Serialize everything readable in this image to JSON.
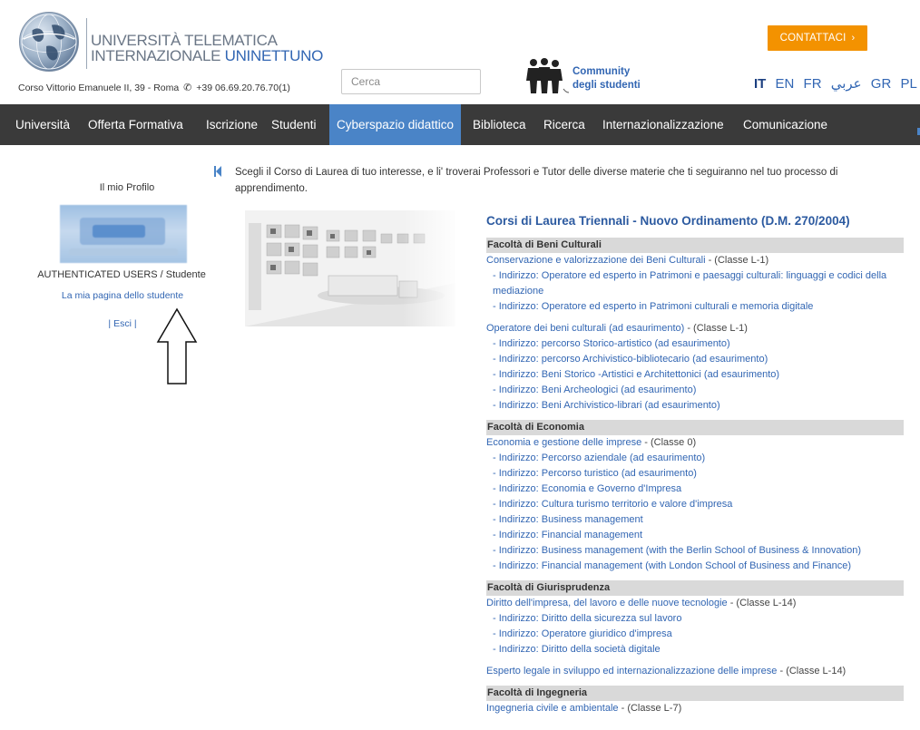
{
  "header": {
    "logo_line1": "UNIVERSITÀ TELEMATICA",
    "logo_line2_prefix": "INTERNAZIONALE ",
    "logo_line2_accent": "UNINETTUNO",
    "address_text": "Corso Vittorio Emanuele II, 39 - Roma",
    "phone_number": "+39 06.69.20.76.70(1)",
    "search_placeholder": "Cerca",
    "community_line1": "Community",
    "community_line2": "degli studenti",
    "contact_label": "CONTATTACI",
    "contact_color": "#f39200",
    "languages": [
      "IT",
      "EN",
      "FR",
      "عربي",
      "GR",
      "PL"
    ],
    "active_language": "IT"
  },
  "nav": {
    "items": [
      "Università",
      "Offerta Formativa",
      "Iscrizione",
      "Studenti",
      "Cyberspazio didattico",
      "Biblioteca",
      "Ricerca",
      "Internazionalizzazione",
      "Comunicazione"
    ],
    "active": "Cyberspazio didattico",
    "bar_color": "#3a3a3a",
    "active_color": "#4a84c7"
  },
  "sidebar": {
    "title": "Il mio Profilo",
    "role": "AUTHENTICATED USERS / Studente",
    "student_page_link": "La mia pagina dello studente",
    "logout": "| Esci |"
  },
  "main": {
    "intro": "Scegli il Corso di Laurea di tuo interesse, e li' troverai Professori e Tutor delle diverse materie che ti seguiranno nel tuo processo di apprendimento.",
    "section_title": "Corsi di Laurea Triennali - Nuovo Ordinamento (D.M. 270/2004)",
    "faculties": [
      {
        "name": "Facoltà di Beni Culturali",
        "courses": [
          {
            "name": "Conservazione e valorizzazione dei Beni Culturali",
            "classe": " - (Classe L-1)",
            "indirizzi": [
              "- Indirizzo: Operatore ed esperto in Patrimoni e paesaggi culturali: linguaggi e codici della mediazione",
              "- Indirizzo: Operatore ed esperto in Patrimoni culturali e memoria digitale"
            ]
          },
          {
            "name": "Operatore dei beni culturali (ad esaurimento)",
            "classe": " - (Classe L-1)",
            "indirizzi": [
              "- Indirizzo: percorso Storico-artistico (ad esaurimento)",
              "- Indirizzo: percorso Archivistico-bibliotecario (ad esaurimento)",
              "- Indirizzo: Beni Storico -Artistici e Architettonici (ad esaurimento)",
              "- Indirizzo: Beni Archeologici (ad esaurimento)",
              "- Indirizzo: Beni Archivistico-librari (ad esaurimento)"
            ]
          }
        ]
      },
      {
        "name": "Facoltà di Economia",
        "courses": [
          {
            "name": "Economia e gestione delle imprese",
            "classe": " - (Classe 0)",
            "indirizzi": [
              "- Indirizzo: Percorso aziendale (ad esaurimento)",
              "- Indirizzo: Percorso turistico (ad esaurimento)",
              "- Indirizzo: Economia e Governo d'Impresa",
              "- Indirizzo: Cultura turismo territorio e valore d'impresa",
              "- Indirizzo: Business management",
              "- Indirizzo: Financial management",
              "- Indirizzo: Business management (with the Berlin School of Business & Innovation)",
              "- Indirizzo: Financial management (with London School of Business and Finance)"
            ]
          }
        ]
      },
      {
        "name": "Facoltà di Giurisprudenza",
        "courses": [
          {
            "name": "Diritto dell'impresa, del lavoro e delle nuove tecnologie",
            "classe": " - (Classe L-14)",
            "indirizzi": [
              "- Indirizzo: Diritto della sicurezza sul lavoro",
              "- Indirizzo: Operatore giuridico d'impresa",
              "- Indirizzo: Diritto della società digitale"
            ]
          },
          {
            "name": "Esperto legale in sviluppo ed internazionalizzazione delle imprese",
            "classe": " - (Classe L-14)",
            "indirizzi": []
          }
        ]
      },
      {
        "name": "Facoltà di Ingegneria",
        "courses": [
          {
            "name": "Ingegneria civile e ambientale",
            "classe": " - (Classe L-7)",
            "indirizzi": []
          }
        ]
      }
    ]
  }
}
